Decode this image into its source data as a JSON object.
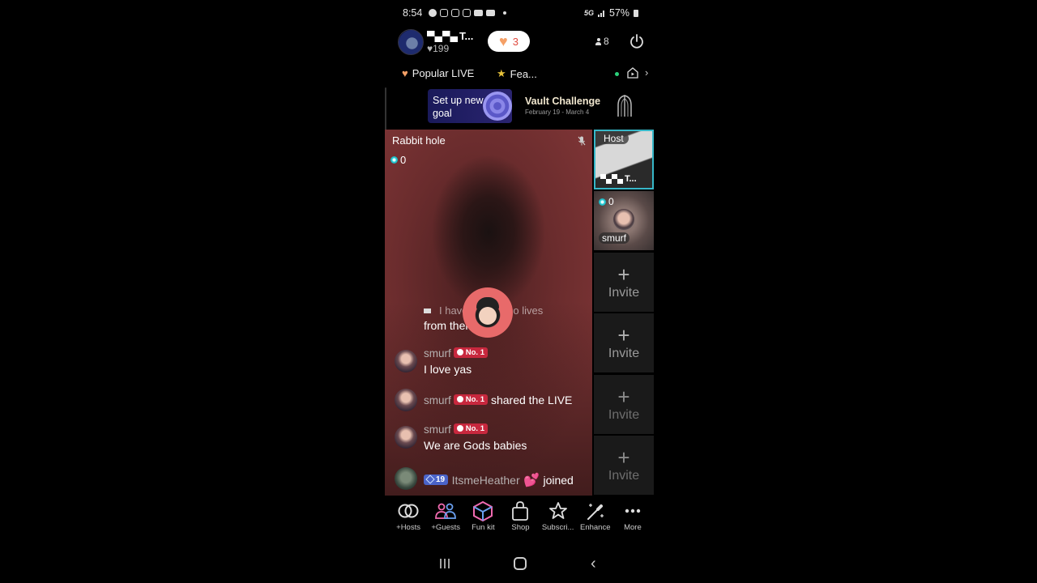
{
  "status_bar": {
    "time": "8:54",
    "notification_icons": [
      "facebook-icon",
      "instagram-icon",
      "instagram-icon",
      "instagram-icon",
      "youtube-icon",
      "youtube-icon",
      "dot-icon"
    ],
    "network": "5G",
    "battery": "57%"
  },
  "header": {
    "host_name": "T...",
    "likes": "199",
    "heart_count": "3",
    "viewer_count": "8"
  },
  "tabs": [
    {
      "label": "Popular LIVE",
      "icon": "heart-icon"
    },
    {
      "label": "Fea...",
      "icon": "star-person-icon"
    }
  ],
  "banners": {
    "goal": "Set up new goal",
    "goal_line1": "Set up new",
    "goal_line2": "goal",
    "vault_title": "Vault Challenge",
    "vault_dates": "February 19 - March 4"
  },
  "main_video": {
    "room_title": "Rabbit hole",
    "coins": "0"
  },
  "chat": {
    "faded_line1": "I haven't seen no lives",
    "faded_line2": "from them",
    "messages": [
      {
        "user": "smurf",
        "badge": "No. 1",
        "text": "I love yas"
      },
      {
        "user": "smurf",
        "badge": "No. 1",
        "action": "shared the LIVE"
      },
      {
        "user": "smurf",
        "badge": "No. 1",
        "text": "We are Gods babies"
      },
      {
        "user": "ItsmeHeather",
        "level": "19",
        "emoji": "💕",
        "action": "joined"
      }
    ]
  },
  "side_panel": {
    "host_tag": "Host",
    "host_name": "T...",
    "guest": {
      "coins": "0",
      "name": "smurf"
    },
    "invite_label": "Invite",
    "invite_plus": "+"
  },
  "toolbar": [
    {
      "label": "+Hosts",
      "icon": "hosts-link-icon"
    },
    {
      "label": "+Guests",
      "icon": "guests-icon"
    },
    {
      "label": "Fun kit",
      "icon": "cube-icon"
    },
    {
      "label": "Shop",
      "icon": "shopping-bag-icon"
    },
    {
      "label": "Subscri...",
      "icon": "subscribe-star-icon"
    },
    {
      "label": "Enhance",
      "icon": "magic-wand-icon"
    },
    {
      "label": "More",
      "icon": "more-dots-icon"
    }
  ],
  "colors": {
    "accent_pink": "#c8283e",
    "host_border": "#37b7c8",
    "level_badge": "#4a63c8",
    "heart_orange": "#f5a066",
    "live_dot": "#2bd07a"
  }
}
